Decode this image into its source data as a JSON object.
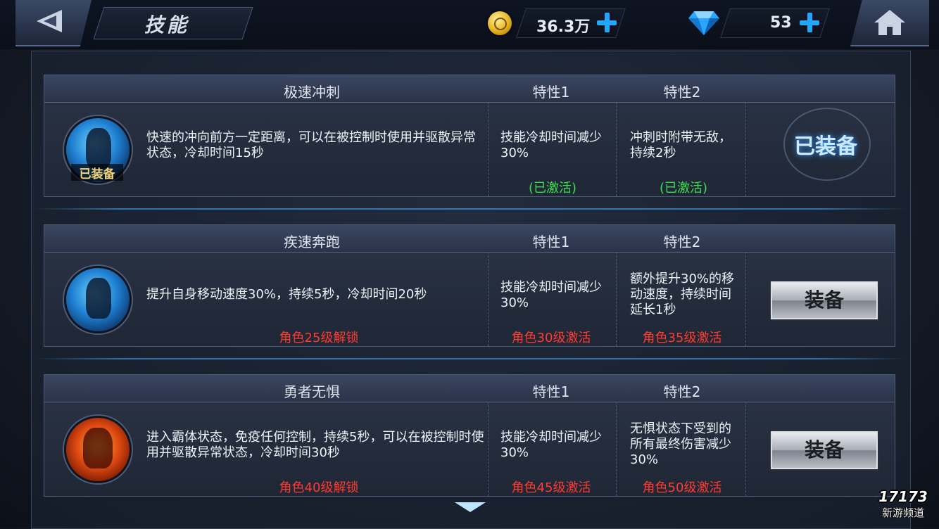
{
  "header": {
    "title": "技能",
    "coins": "36.3万",
    "gems": "53"
  },
  "skills": [
    {
      "name": "极速冲刺",
      "trait1_header": "特性1",
      "trait2_header": "特性2",
      "equipped_tag": "已装备",
      "description": "快速的冲向前方一定距离，可以在被控制时使用并驱散异常状态，冷却时间15秒",
      "trait1": "技能冷却时间减少30%",
      "trait1_status": "(已激活)",
      "trait2": "冲刺时附带无敌，持续2秒",
      "trait2_status": "(已激活)",
      "action": "已装备",
      "icon": "dash-skill-icon"
    },
    {
      "name": "疾速奔跑",
      "trait1_header": "特性1",
      "trait2_header": "特性2",
      "description": "提升自身移动速度30%，持续5秒，冷却时间20秒",
      "unlock": "角色25级解锁",
      "trait1": "技能冷却时间减少30%",
      "trait1_status": "角色30级激活",
      "trait2": "额外提升30%的移动速度，持续时间延长1秒",
      "trait2_status": "角色35级激活",
      "action": "装备",
      "icon": "sprint-skill-icon"
    },
    {
      "name": "勇者无惧",
      "trait1_header": "特性1",
      "trait2_header": "特性2",
      "description": "进入霸体状态，免疫任何控制，持续5秒，可以在被控制时使用并驱散异常状态，冷却时间30秒",
      "unlock": "角色40级解锁",
      "trait1": "技能冷却时间减少30%",
      "trait1_status": "角色45级激活",
      "trait2": "无惧状态下受到的所有最终伤害减少30%",
      "trait2_status": "角色50级激活",
      "action": "装备",
      "icon": "fearless-skill-icon"
    }
  ],
  "watermark": {
    "line1": "17173",
    "line2": "新游频道"
  },
  "colors": {
    "active_green": "#3ddf4f",
    "locked_red": "#ff3b30",
    "accent_blue": "#20a8ff"
  }
}
